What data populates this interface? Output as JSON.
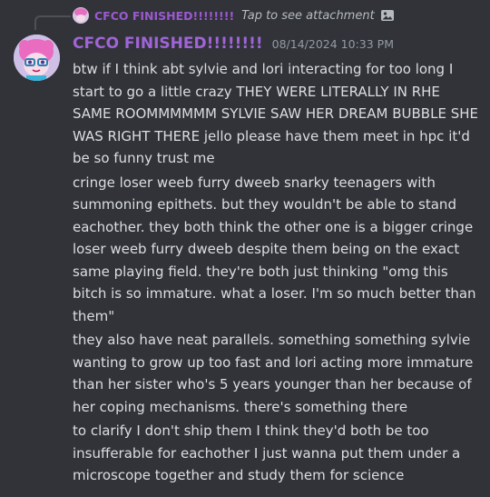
{
  "reply": {
    "author": "CFCO FINISHED!!!!!!!!",
    "preview": "Tap to see attachment",
    "icon": "image-icon"
  },
  "author": {
    "name": "CFCO FINISHED!!!!!!!!",
    "name_color": "#a064d8",
    "timestamp": "08/14/2024 10:33 PM"
  },
  "messages": [
    "btw if I think abt sylvie and lori interacting for too long I start to go a little crazy THEY WERE LITERALLY IN RHE SAME ROOMMMMMM SYLVIE SAW HER DREAM BUBBLE SHE WAS RIGHT THERE jello please have them meet in hpc it'd be so funny trust me",
    "cringe loser weeb furry dweeb snarky teenagers with summoning epithets. but they wouldn't be able to stand eachother. they both think the other one is a bigger cringe loser weeb furry dweeb despite them being on the exact same playing field. they're both just thinking \"omg this bitch is so immature. what a loser. I'm so much better than them\"",
    "they also have neat parallels. something something sylvie wanting to grow up too fast and lori acting more immature than her sister who's 5 years younger than her because of her coping mechanisms. there's something there",
    "to clarify I don't ship them I think they'd both be too insufferable for eachother I just wanna put them under a microscope together and study them for science"
  ]
}
